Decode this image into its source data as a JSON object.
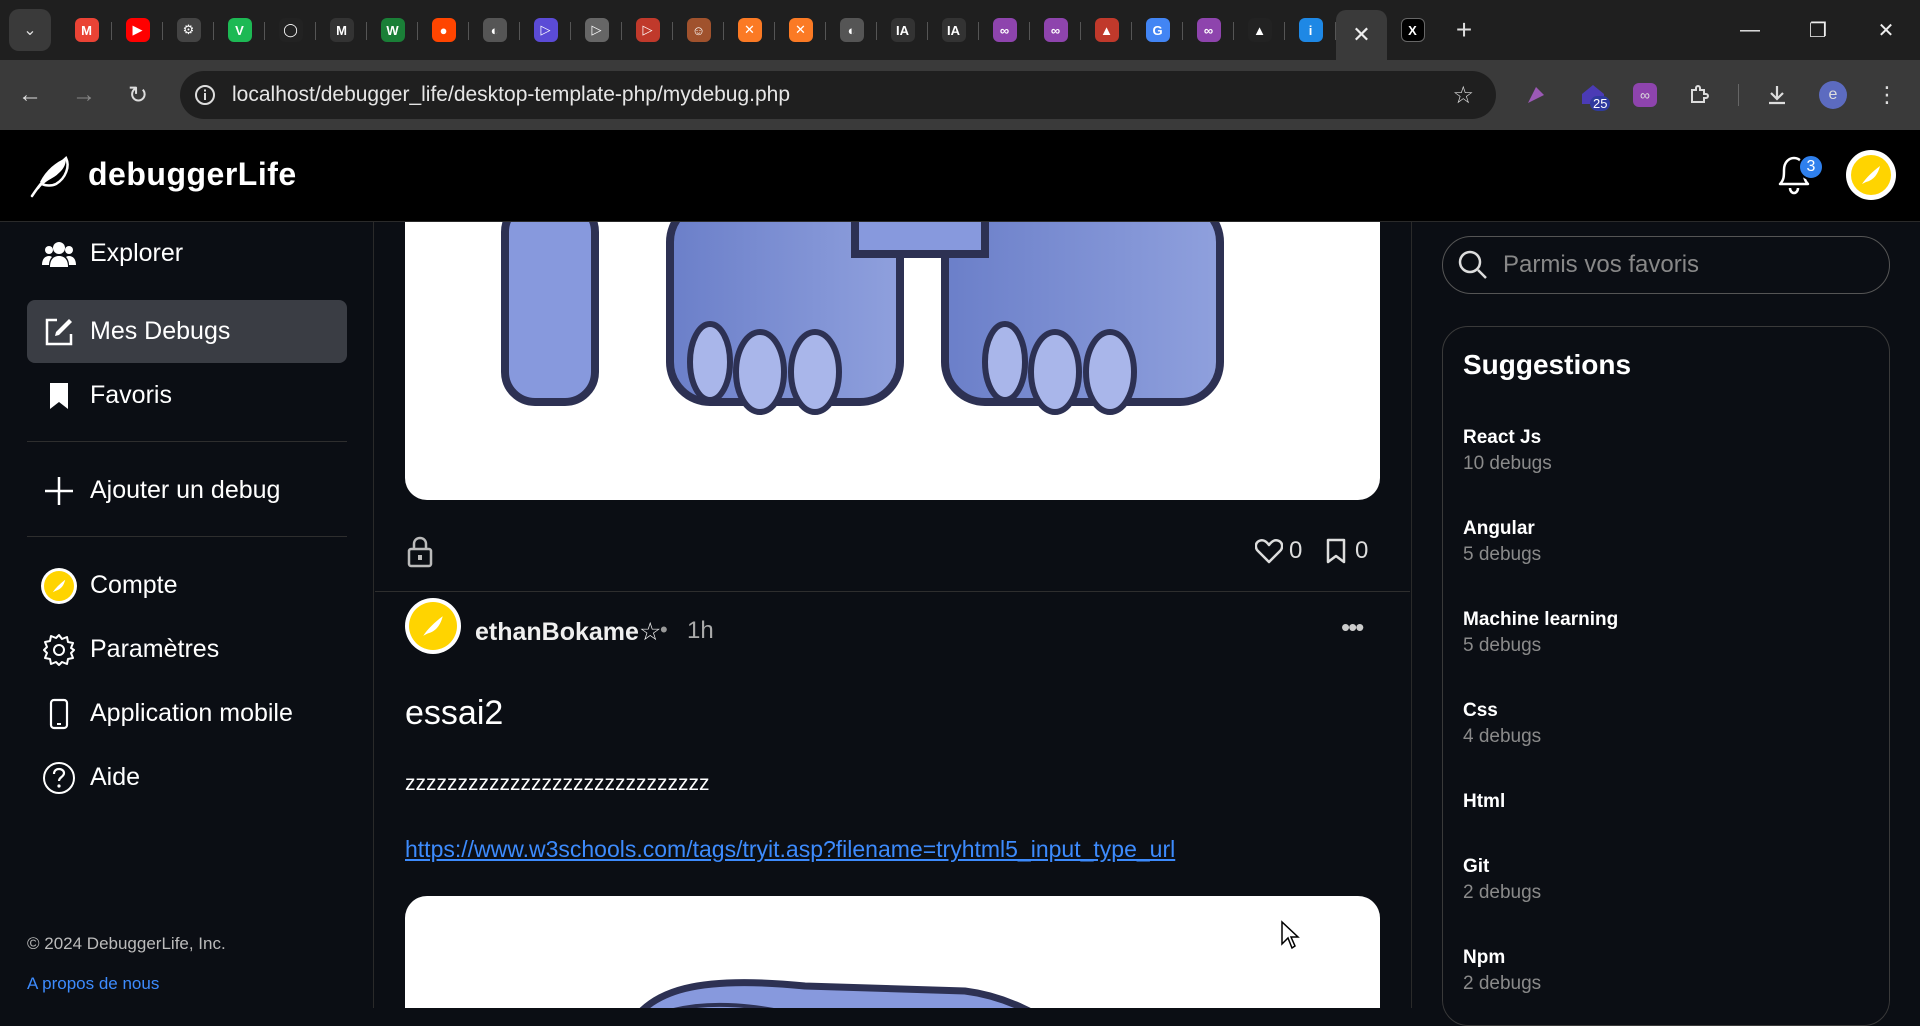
{
  "browser": {
    "url": "localhost/debugger_life/desktop-template-php/mydebug.php",
    "extension_badge": "25",
    "profile_initial": "e",
    "tabs": [
      {
        "icon": "gmail-icon",
        "glyph": "M",
        "color": "#ea4335"
      },
      {
        "icon": "youtube-icon",
        "glyph": "▶",
        "color": "#ff0000"
      },
      {
        "icon": "chatgpt-icon",
        "glyph": "⚙",
        "color": "#444"
      },
      {
        "icon": "v-logo-icon",
        "glyph": "V",
        "color": "#1db954"
      },
      {
        "icon": "github-icon",
        "glyph": "◯",
        "color": "#222"
      },
      {
        "icon": "medium-icon",
        "glyph": "M",
        "color": "#333"
      },
      {
        "icon": "w-logo-icon",
        "glyph": "W",
        "color": "#1a7f37"
      },
      {
        "icon": "reddit-icon",
        "glyph": "●",
        "color": "#ff4500"
      },
      {
        "icon": "globe-icon",
        "glyph": "◐",
        "color": "#555"
      },
      {
        "icon": "play-circle-icon",
        "glyph": "▷",
        "color": "#5b4bd6"
      },
      {
        "icon": "play-circle-icon",
        "glyph": "▷",
        "color": "#666"
      },
      {
        "icon": "play-circle-icon",
        "glyph": "▷",
        "color": "#c0392b"
      },
      {
        "icon": "cartoon-icon",
        "glyph": "☺",
        "color": "#a0522d"
      },
      {
        "icon": "xampp-icon",
        "glyph": "✕",
        "color": "#fb7a24"
      },
      {
        "icon": "xampp-icon",
        "glyph": "✕",
        "color": "#fb7a24"
      },
      {
        "icon": "globe-icon",
        "glyph": "◐",
        "color": "#555"
      },
      {
        "icon": "ia-icon",
        "glyph": "IA",
        "color": "#333"
      },
      {
        "icon": "ia-icon",
        "glyph": "IA",
        "color": "#333"
      },
      {
        "icon": "purple-app-icon",
        "glyph": "∞",
        "color": "#8e44ad"
      },
      {
        "icon": "purple-app-icon",
        "glyph": "∞",
        "color": "#8e44ad"
      },
      {
        "icon": "maa-icon",
        "glyph": "▲",
        "color": "#c0392b"
      },
      {
        "icon": "google-icon",
        "glyph": "G",
        "color": "#4285f4"
      },
      {
        "icon": "purple-app-icon",
        "glyph": "∞",
        "color": "#8e44ad"
      },
      {
        "icon": "triangle-icon",
        "glyph": "▲",
        "color": "#222"
      },
      {
        "icon": "info-app-icon",
        "glyph": "i",
        "color": "#1e88e5"
      }
    ]
  },
  "app": {
    "brand": "debuggerLife",
    "notification_count": "3"
  },
  "sidebar": {
    "items": [
      {
        "label": "Explorer"
      },
      {
        "label": "Mes Debugs"
      },
      {
        "label": "Favoris"
      },
      {
        "label": "Ajouter un debug"
      },
      {
        "label": "Compte"
      },
      {
        "label": "Paramètres"
      },
      {
        "label": "Application mobile"
      },
      {
        "label": "Aide"
      }
    ],
    "copyright": "© 2024 DebuggerLife, Inc.",
    "about": "A propos de nous"
  },
  "feed": {
    "prev_post": {
      "likes": "0",
      "saves": "0"
    },
    "post": {
      "author": "ethanBokame☆",
      "separator": "•",
      "time": "1h",
      "title": "essai2",
      "body": "zzzzzzzzzzzzzzzzzzzzzzzzzzzzz",
      "link": "https://www.w3schools.com/tags/tryit.asp?filename=tryhtml5_input_type_url"
    }
  },
  "right": {
    "search_placeholder": "Parmis vos favoris",
    "suggestions_title": "Suggestions",
    "suggestions": [
      {
        "name": "React Js",
        "count": "10 debugs"
      },
      {
        "name": "Angular",
        "count": "5 debugs"
      },
      {
        "name": "Machine learning",
        "count": "5 debugs"
      },
      {
        "name": "Css",
        "count": "4 debugs"
      },
      {
        "name": "Html",
        "count": ""
      },
      {
        "name": "Git",
        "count": "2 debugs"
      },
      {
        "name": "Npm",
        "count": "2 debugs"
      }
    ]
  },
  "colors": {
    "accent": "#3d8bfd",
    "active_nav": "#3a3d44",
    "badge": "#2f80ed"
  }
}
